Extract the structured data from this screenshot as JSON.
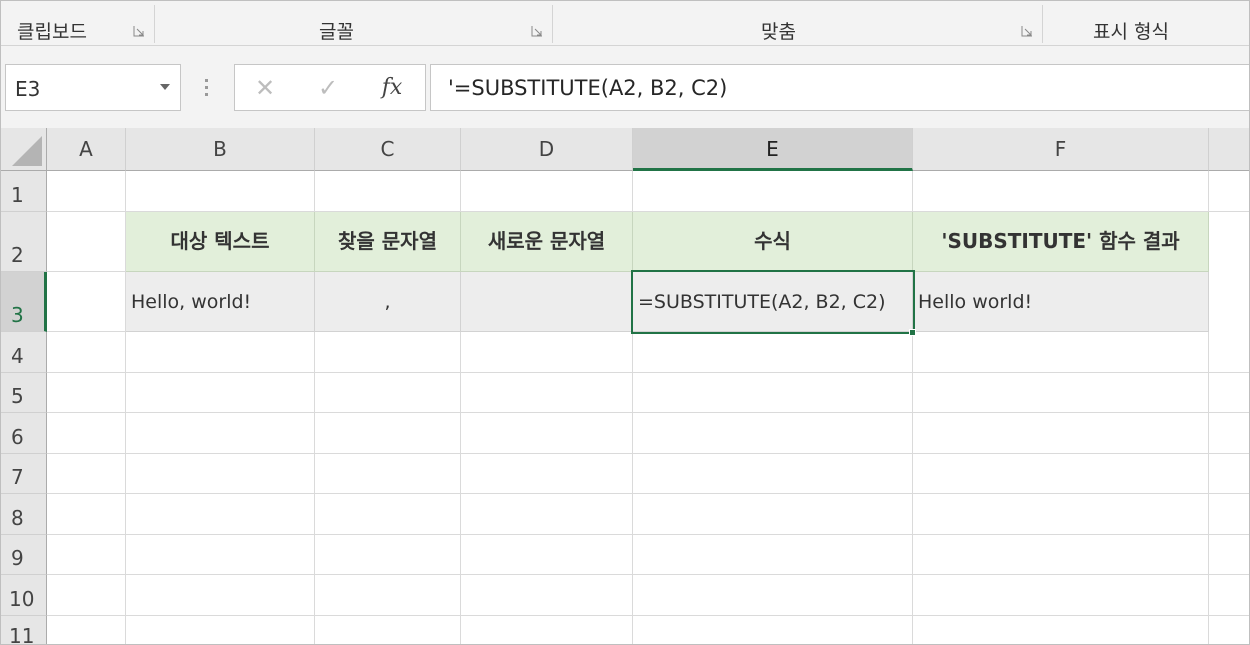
{
  "ribbon": {
    "groups": [
      {
        "label": "클립보드"
      },
      {
        "label": "글꼴"
      },
      {
        "label": "맞춤"
      },
      {
        "label": "표시 형식"
      }
    ]
  },
  "formula_bar": {
    "name_box": "E3",
    "cancel_symbol": "✕",
    "enter_symbol": "✓",
    "fx_label": "fx",
    "formula": "'=SUBSTITUTE(A2, B2, C2)"
  },
  "sheet": {
    "columns": [
      "A",
      "B",
      "C",
      "D",
      "E",
      "F"
    ],
    "selected_column": "E",
    "rows": [
      "1",
      "2",
      "3",
      "4",
      "5",
      "6",
      "7",
      "8",
      "9",
      "10",
      "11"
    ],
    "selected_row": "3",
    "header_row": {
      "B": "대상 텍스트",
      "C": "찾을 문자열",
      "D": "새로운 문자열",
      "E": "수식",
      "F": "'SUBSTITUTE' 함수 결과"
    },
    "data_row": {
      "B": "Hello, world!",
      "C": ",",
      "D": "",
      "E": "=SUBSTITUTE(A2, B2, C2)",
      "F": "Hello world!"
    },
    "active_cell": "E3",
    "colors": {
      "header_fill": "#e2efda",
      "data_fill": "#ededed",
      "selection": "#217346"
    }
  }
}
